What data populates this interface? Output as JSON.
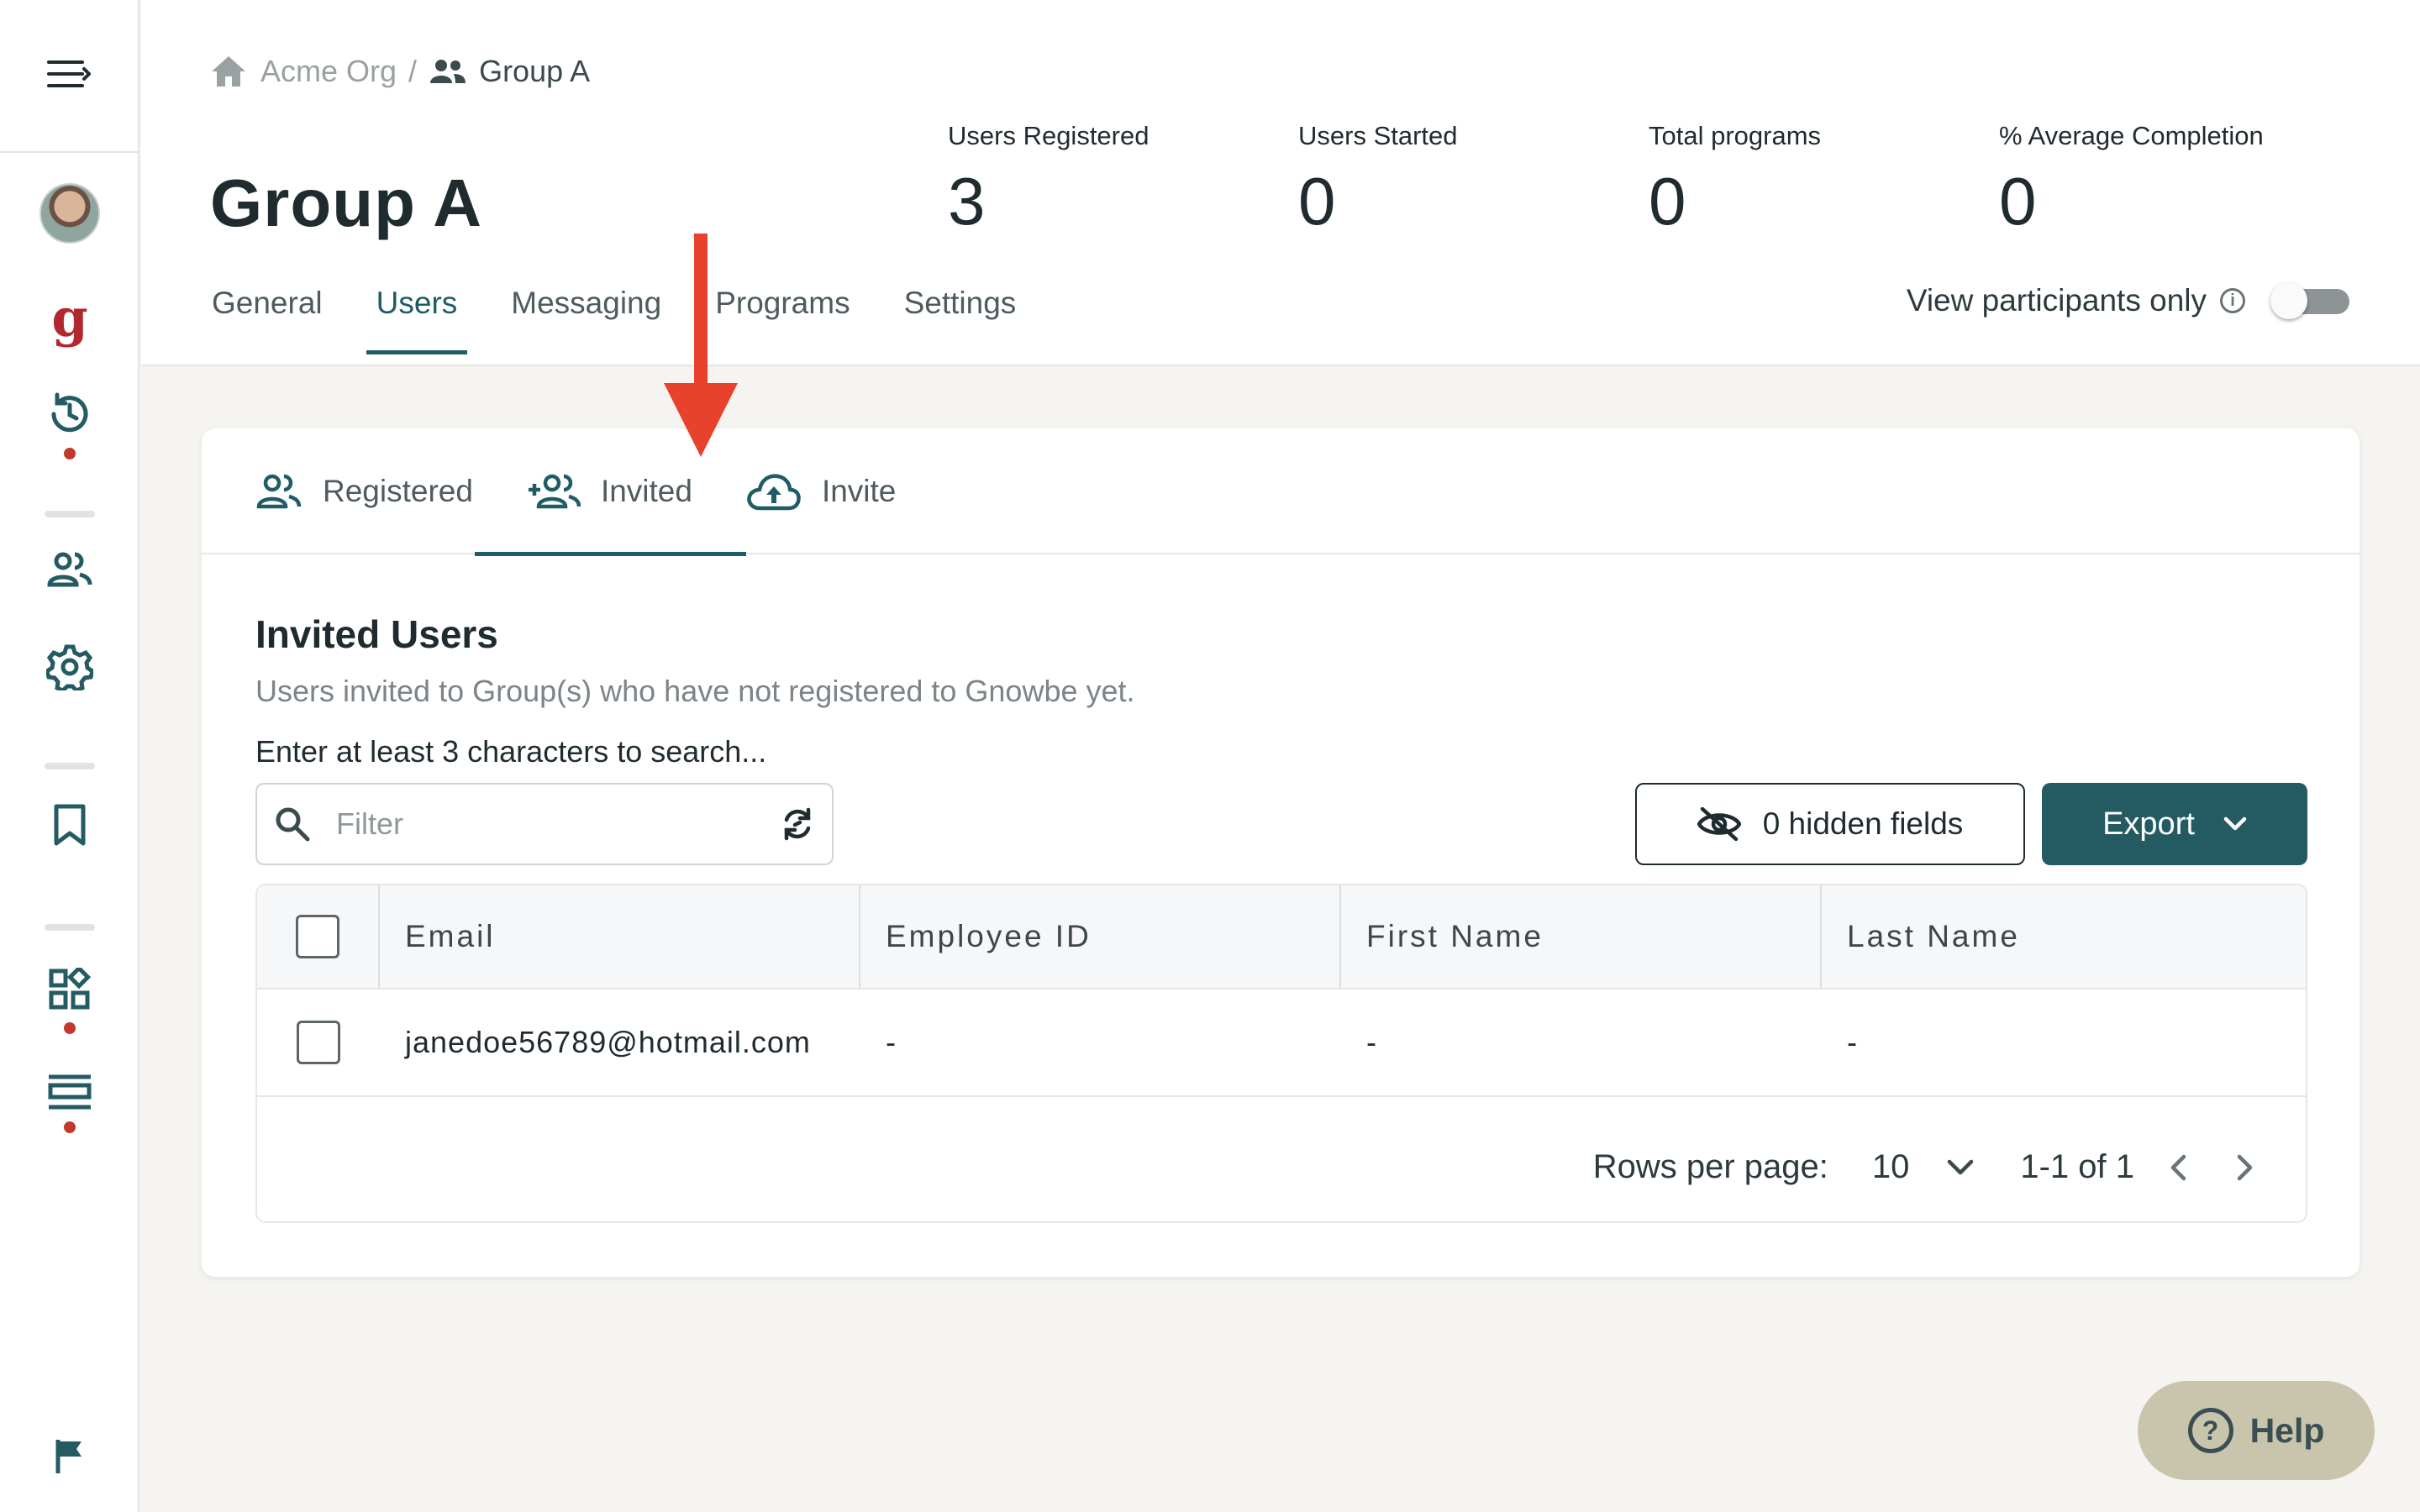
{
  "breadcrumb": {
    "org": "Acme Org",
    "separator": "/",
    "group": "Group A"
  },
  "page_title": "Group A",
  "stats": [
    {
      "label": "Users Registered",
      "value": "3"
    },
    {
      "label": "Users Started",
      "value": "0"
    },
    {
      "label": "Total programs",
      "value": "0"
    },
    {
      "label": "% Average Completion",
      "value": "0"
    }
  ],
  "tabs": [
    {
      "label": "General"
    },
    {
      "label": "Users"
    },
    {
      "label": "Messaging"
    },
    {
      "label": "Programs"
    },
    {
      "label": "Settings"
    }
  ],
  "active_tab": "Users",
  "view_participants": {
    "label": "View participants only",
    "enabled": false
  },
  "subtabs": [
    {
      "label": "Registered",
      "icon": "users-icon"
    },
    {
      "label": "Invited",
      "icon": "add-users-icon"
    },
    {
      "label": "Invite",
      "icon": "cloud-upload-icon"
    }
  ],
  "active_subtab": "Invited",
  "section": {
    "title": "Invited Users",
    "description": "Users invited to Group(s) who have not registered to Gnowbe yet.",
    "search_hint": "Enter at least 3 characters to search..."
  },
  "filter": {
    "placeholder": "Filter",
    "value": ""
  },
  "hidden_fields_label": "0 hidden fields",
  "export_label": "Export",
  "table": {
    "columns": [
      "Email",
      "Employee ID",
      "First Name",
      "Last Name"
    ],
    "rows": [
      {
        "email": "janedoe56789@hotmail.com",
        "employee_id": "-",
        "first_name": "-",
        "last_name": "-"
      }
    ]
  },
  "pagination": {
    "rows_per_page_label": "Rows per page:",
    "rows_per_page": "10",
    "range": "1-1 of 1"
  },
  "help_label": "Help",
  "colors": {
    "accent": "#245b63",
    "brand_red": "#b3282d",
    "help_bg": "#c9c5ad",
    "annotation_arrow": "#e8412c"
  }
}
